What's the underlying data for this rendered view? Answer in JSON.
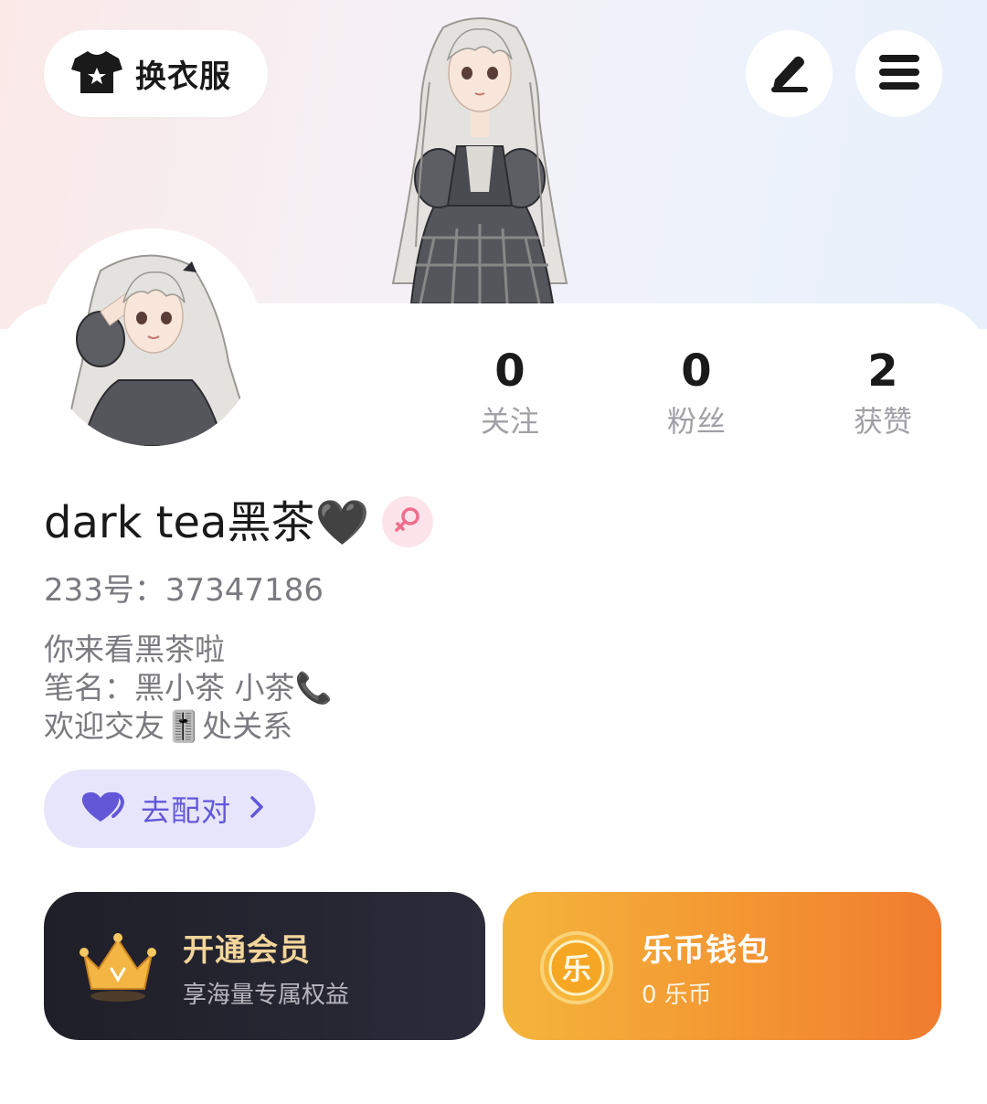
{
  "header": {
    "outfit_button_label": "换衣服",
    "icons": [
      "tshirt-icon",
      "pencil-icon",
      "menu-icon"
    ]
  },
  "stats": [
    {
      "value": "0",
      "label": "关注"
    },
    {
      "value": "0",
      "label": "粉丝"
    },
    {
      "value": "2",
      "label": "获赞"
    }
  ],
  "profile": {
    "username": "dark tea黑茶🖤",
    "gender": "female",
    "uid_label": "233号：",
    "uid": "37347186",
    "bio_lines": [
      "你来看黑茶啦",
      "笔名：黑小茶  小茶📞",
      "欢迎交友🎚️处关系"
    ]
  },
  "match_button": {
    "label": "去配对",
    "icon": "heart-icon"
  },
  "vip_card": {
    "title": "开通会员",
    "subtitle": "享海量专属权益",
    "icon": "crown-icon"
  },
  "wallet_card": {
    "title": "乐币钱包",
    "subtitle": "0 乐币",
    "coin_glyph": "乐",
    "icon": "coin-icon"
  },
  "colors": {
    "accent_purple": "#6357d8",
    "vip_gold": "#f3d59a",
    "wallet_orange": "#f39632",
    "gender_pink": "#f06c8c"
  }
}
